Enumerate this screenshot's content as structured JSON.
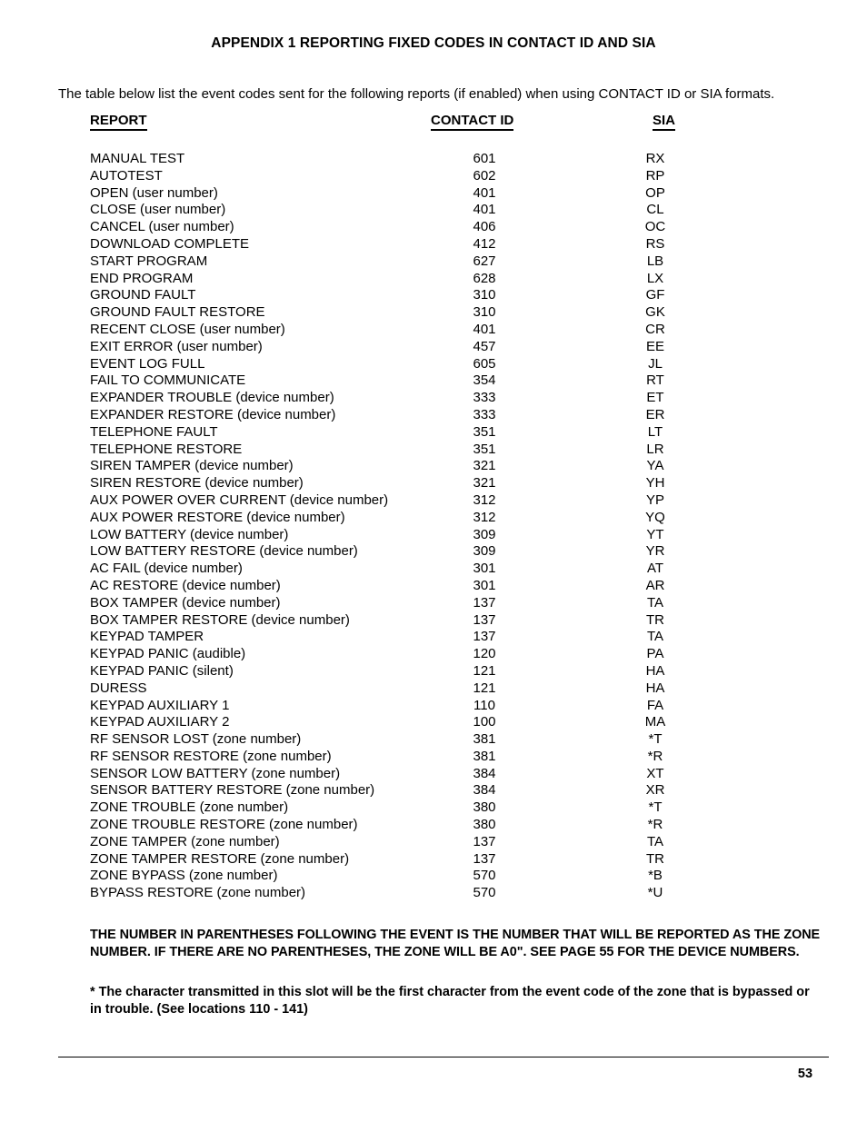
{
  "document": {
    "title": "APPENDIX 1 REPORTING FIXED CODES IN CONTACT ID AND SIA",
    "intro": "The table below list the event codes sent for the following reports (if enabled) when using CONTACT ID or SIA formats.",
    "page_number": "53"
  },
  "table": {
    "headers": {
      "report": "REPORT",
      "contact_id": "CONTACT ID",
      "sia": "SIA"
    },
    "rows": [
      {
        "report": "MANUAL TEST",
        "contact_id": "601",
        "sia": "RX"
      },
      {
        "report": "AUTOTEST",
        "contact_id": "602",
        "sia": "RP"
      },
      {
        "report": "OPEN (user number)",
        "contact_id": "401",
        "sia": "OP"
      },
      {
        "report": "CLOSE (user number)",
        "contact_id": "401",
        "sia": "CL"
      },
      {
        "report": "CANCEL (user number)",
        "contact_id": "406",
        "sia": "OC"
      },
      {
        "report": "DOWNLOAD COMPLETE",
        "contact_id": "412",
        "sia": "RS"
      },
      {
        "report": "START PROGRAM",
        "contact_id": "627",
        "sia": "LB"
      },
      {
        "report": "END PROGRAM",
        "contact_id": "628",
        "sia": "LX"
      },
      {
        "report": "GROUND FAULT",
        "contact_id": "310",
        "sia": "GF"
      },
      {
        "report": "GROUND FAULT RESTORE",
        "contact_id": "310",
        "sia": "GK"
      },
      {
        "report": "RECENT CLOSE (user number)",
        "contact_id": "401",
        "sia": "CR"
      },
      {
        "report": "EXIT ERROR (user number)",
        "contact_id": "457",
        "sia": "EE"
      },
      {
        "report": "EVENT LOG FULL",
        "contact_id": "605",
        "sia": "JL"
      },
      {
        "report": "FAIL TO COMMUNICATE",
        "contact_id": "354",
        "sia": "RT"
      },
      {
        "report": "EXPANDER TROUBLE (device number)",
        "contact_id": "333",
        "sia": "ET"
      },
      {
        "report": "EXPANDER RESTORE (device number)",
        "contact_id": "333",
        "sia": "ER"
      },
      {
        "report": "TELEPHONE FAULT",
        "contact_id": "351",
        "sia": "LT"
      },
      {
        "report": "TELEPHONE RESTORE",
        "contact_id": "351",
        "sia": "LR"
      },
      {
        "report": "SIREN TAMPER (device number)",
        "contact_id": "321",
        "sia": "YA"
      },
      {
        "report": "SIREN RESTORE (device number)",
        "contact_id": "321",
        "sia": "YH"
      },
      {
        "report": "AUX POWER OVER CURRENT (device number)",
        "contact_id": "312",
        "sia": "YP"
      },
      {
        "report": "AUX POWER RESTORE (device number)",
        "contact_id": "312",
        "sia": "YQ"
      },
      {
        "report": "LOW BATTERY (device number)",
        "contact_id": "309",
        "sia": "YT"
      },
      {
        "report": "LOW BATTERY RESTORE (device number)",
        "contact_id": "309",
        "sia": "YR"
      },
      {
        "report": "AC FAIL (device number)",
        "contact_id": "301",
        "sia": "AT"
      },
      {
        "report": "AC RESTORE (device number)",
        "contact_id": "301",
        "sia": "AR"
      },
      {
        "report": "BOX TAMPER (device number)",
        "contact_id": "137",
        "sia": "TA"
      },
      {
        "report": "BOX TAMPER RESTORE (device number)",
        "contact_id": "137",
        "sia": "TR"
      },
      {
        "report": "KEYPAD TAMPER",
        "contact_id": "137",
        "sia": "TA"
      },
      {
        "report": "KEYPAD PANIC (audible)",
        "contact_id": "120",
        "sia": "PA"
      },
      {
        "report": "KEYPAD PANIC (silent)",
        "contact_id": "121",
        "sia": "HA"
      },
      {
        "report": "DURESS",
        "contact_id": "121",
        "sia": "HA"
      },
      {
        "report": "KEYPAD AUXILIARY 1",
        "contact_id": "110",
        "sia": "FA"
      },
      {
        "report": "KEYPAD AUXILIARY 2",
        "contact_id": "100",
        "sia": "MA"
      },
      {
        "report": "RF SENSOR LOST (zone number)",
        "contact_id": "381",
        "sia": "*T"
      },
      {
        "report": "RF SENSOR RESTORE (zone number)",
        "contact_id": "381",
        "sia": "*R"
      },
      {
        "report": "SENSOR LOW BATTERY (zone number)",
        "contact_id": "384",
        "sia": "XT"
      },
      {
        "report": "SENSOR BATTERY RESTORE (zone number)",
        "contact_id": "384",
        "sia": "XR"
      },
      {
        "report": "ZONE TROUBLE (zone number)",
        "contact_id": "380",
        "sia": "*T"
      },
      {
        "report": "ZONE TROUBLE RESTORE (zone number)",
        "contact_id": "380",
        "sia": "*R"
      },
      {
        "report": "ZONE TAMPER (zone number)",
        "contact_id": "137",
        "sia": "TA"
      },
      {
        "report": "ZONE TAMPER RESTORE (zone number)",
        "contact_id": "137",
        "sia": "TR"
      },
      {
        "report": "ZONE BYPASS (zone number)",
        "contact_id": "570",
        "sia": "*B"
      },
      {
        "report": "BYPASS RESTORE (zone number)",
        "contact_id": "570",
        "sia": "*U"
      }
    ]
  },
  "notes": {
    "note_1": "THE NUMBER IN PARENTHESES FOLLOWING THE EVENT IS THE NUMBER THAT WILL BE REPORTED AS THE ZONE NUMBER. IF THERE ARE NO PARENTHESES, THE ZONE WILL BE A0\". SEE PAGE 55 FOR THE DEVICE NUMBERS.",
    "note_2": "* The character transmitted in this slot will be the first character from the event code of the zone that is bypassed or in trouble.  (See locations 110 - 141)"
  }
}
